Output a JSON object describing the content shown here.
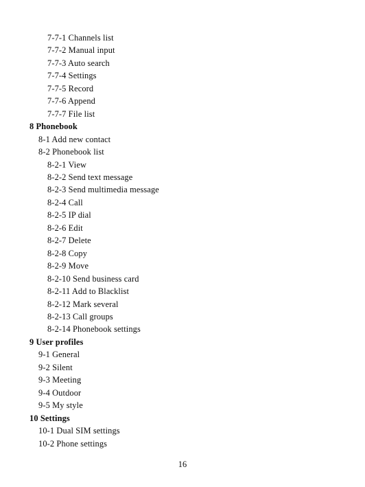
{
  "document": {
    "page_number": "16",
    "text_color": "#0d0d0d",
    "background_color": "#ffffff"
  },
  "toc": {
    "entries": [
      {
        "text": "7-7-1 Channels list",
        "level": 3,
        "bold": false
      },
      {
        "text": "7-7-2 Manual input",
        "level": 3,
        "bold": false
      },
      {
        "text": "7-7-3 Auto search",
        "level": 3,
        "bold": false
      },
      {
        "text": "7-7-4 Settings",
        "level": 3,
        "bold": false
      },
      {
        "text": "7-7-5 Record",
        "level": 3,
        "bold": false
      },
      {
        "text": "7-7-6 Append",
        "level": 3,
        "bold": false
      },
      {
        "text": "7-7-7 File list",
        "level": 3,
        "bold": false
      },
      {
        "text": "8 Phonebook",
        "level": 1,
        "bold": true
      },
      {
        "text": "8-1 Add new contact",
        "level": 2,
        "bold": false
      },
      {
        "text": "8-2 Phonebook list",
        "level": 2,
        "bold": false
      },
      {
        "text": "8-2-1 View",
        "level": 3,
        "bold": false
      },
      {
        "text": "8-2-2 Send text message",
        "level": 3,
        "bold": false
      },
      {
        "text": "8-2-3 Send multimedia message",
        "level": 3,
        "bold": false
      },
      {
        "text": "8-2-4 Call",
        "level": 3,
        "bold": false
      },
      {
        "text": "8-2-5 IP dial",
        "level": 3,
        "bold": false
      },
      {
        "text": "8-2-6 Edit",
        "level": 3,
        "bold": false
      },
      {
        "text": "8-2-7 Delete",
        "level": 3,
        "bold": false
      },
      {
        "text": "8-2-8 Copy",
        "level": 3,
        "bold": false
      },
      {
        "text": "8-2-9 Move",
        "level": 3,
        "bold": false
      },
      {
        "text": "8-2-10 Send business card",
        "level": 3,
        "bold": false
      },
      {
        "text": "8-2-11 Add to Blacklist",
        "level": 3,
        "bold": false
      },
      {
        "text": "8-2-12 Mark several",
        "level": 3,
        "bold": false
      },
      {
        "text": "8-2-13 Call groups",
        "level": 3,
        "bold": false
      },
      {
        "text": "8-2-14 Phonebook settings",
        "level": 3,
        "bold": false
      },
      {
        "text": "9 User profiles",
        "level": 1,
        "bold": true
      },
      {
        "text": "9-1 General",
        "level": 2,
        "bold": false
      },
      {
        "text": "9-2 Silent",
        "level": 2,
        "bold": false
      },
      {
        "text": "9-3 Meeting",
        "level": 2,
        "bold": false
      },
      {
        "text": "9-4 Outdoor",
        "level": 2,
        "bold": false
      },
      {
        "text": "9-5 My style",
        "level": 2,
        "bold": false
      },
      {
        "text": "10 Settings",
        "level": 1,
        "bold": true
      },
      {
        "text": "10-1 Dual SIM settings",
        "level": 2,
        "bold": false
      },
      {
        "text": "10-2 Phone settings",
        "level": 2,
        "bold": false
      }
    ]
  }
}
